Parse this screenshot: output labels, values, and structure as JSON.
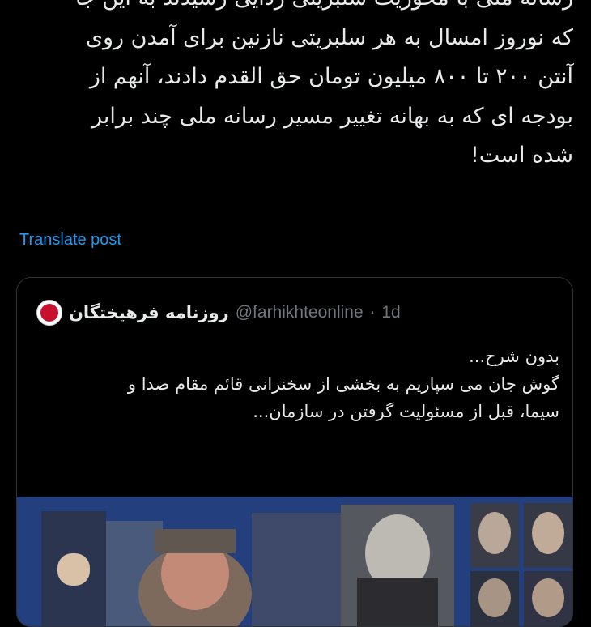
{
  "tweet": {
    "lines": [
      "رسانه ملی با محوریت سلبریتی زدایی رسیدند به این جا",
      "که نوروز امسال به هر  سلبریتی نازنین برای آمدن  روی",
      "آنتن ۲۰۰ تا ۸۰۰ میلیون تومان حق القدم دادند، آنهم از",
      "بودجه ای که به بهانه  تغییر مسیر رسانه ملی چند برابر",
      "شده است!"
    ],
    "translate_label": "Translate post"
  },
  "quote": {
    "avatar_icon": "farhikhtegan-logo-icon",
    "name": "روزنامه فرهیختگان",
    "handle": "@farhikhteonline",
    "separator": "·",
    "time": "1d",
    "lines": [
      "بدون شرح...",
      "گوش جان می سپاریم به بخشی از سخنرانی قائم مقام صدا و",
      "سیما، قبل از مسئولیت گرفتن در سازمان..."
    ]
  },
  "colors": {
    "background": "#000000",
    "text": "#e7e9ea",
    "link": "#1d9bf0",
    "muted": "#71767b",
    "border": "#2f3336",
    "avatar": "#c8102e"
  }
}
